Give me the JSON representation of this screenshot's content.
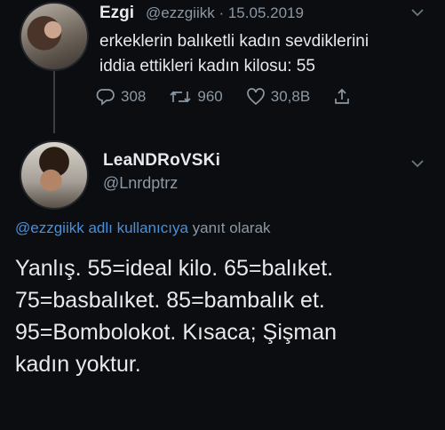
{
  "original_tweet": {
    "author_name": "Ezgi",
    "handle": "@ezzgiikk",
    "date": "· 15.05.2019",
    "text_lines": [
      "erkeklerin balıketli kadın sevdiklerini",
      "iddia ettikleri kadın kilosu: 55"
    ],
    "replies": "308",
    "retweets": "960",
    "likes": "30,8B"
  },
  "reply_tweet": {
    "author_name": "LeaNDRoVSKi",
    "handle": "@Lnrdptrz",
    "reply_to_link": "@ezzgiikk adlı kullanıcıya",
    "reply_to_suffix": "yanıt olarak",
    "text_lines": [
      "Yanlış. 55=ideal kilo. 65=balıket.",
      "75=basbalıket. 85=bambalık et.",
      "95=Bombolokot. Kısaca; Şişman",
      "kadın yoktur."
    ]
  },
  "icons": [
    "chevron-down-icon",
    "reply-icon",
    "retweet-icon",
    "like-icon",
    "share-icon"
  ],
  "colors": {
    "background": "#0b0d10",
    "link": "#4a90d9",
    "muted": "#8b98a5"
  }
}
